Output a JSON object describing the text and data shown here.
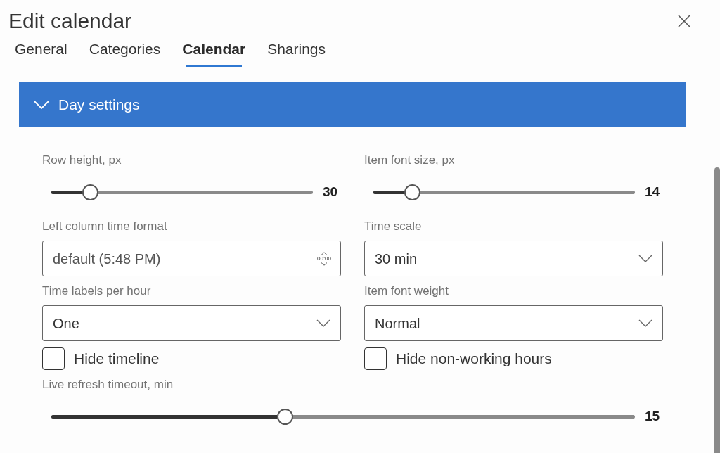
{
  "dialog": {
    "title": "Edit calendar"
  },
  "tabs": [
    {
      "label": "General",
      "selected": false
    },
    {
      "label": "Categories",
      "selected": false
    },
    {
      "label": "Calendar",
      "selected": true
    },
    {
      "label": "Sharings",
      "selected": false
    }
  ],
  "section": {
    "title": "Day settings",
    "expanded": true,
    "rows": [
      [
        {
          "kind": "slider",
          "label": "Row height, px",
          "level": 0.15,
          "reading": "30"
        },
        {
          "kind": "slider",
          "label": "Item font size, px",
          "level": 0.15,
          "reading": "14"
        }
      ],
      [
        {
          "kind": "time",
          "label": "Left column time format",
          "value": "default (5:48 PM)",
          "spinner": "00:00"
        },
        {
          "kind": "select",
          "label": "Time scale",
          "value": "30 min"
        }
      ],
      [
        {
          "kind": "select",
          "label": "Time labels per hour",
          "value": "One"
        },
        {
          "kind": "select",
          "label": "Item font weight",
          "value": "Normal"
        }
      ],
      [
        {
          "kind": "checkbox",
          "label": "Hide timeline",
          "checked": false
        },
        {
          "kind": "checkbox",
          "label": "Hide non-working hours",
          "checked": false
        }
      ],
      [
        {
          "kind": "slider",
          "label": "Live refresh timeout, min",
          "level": 0.4,
          "reading": "15"
        }
      ]
    ]
  }
}
